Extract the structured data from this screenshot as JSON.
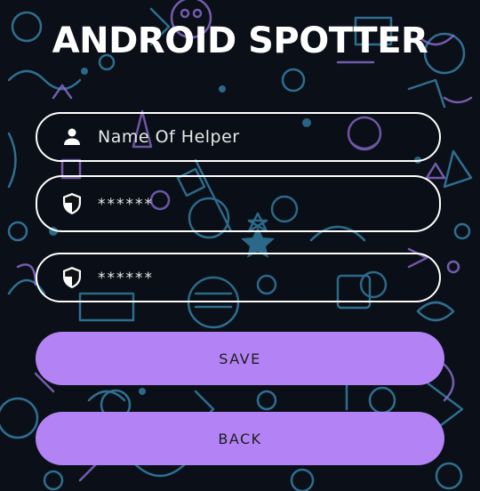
{
  "app": {
    "title": "ANDROID SPOTTER"
  },
  "form": {
    "name_field": {
      "placeholder": "Name Of Helper",
      "value": "",
      "icon": "person-icon"
    },
    "password_field": {
      "placeholder": "******",
      "value": "",
      "icon": "shield-icon"
    },
    "confirm_password_field": {
      "placeholder": "******",
      "value": "",
      "icon": "shield-icon"
    }
  },
  "buttons": {
    "save_label": "SAVE",
    "back_label": "BACK"
  },
  "colors": {
    "background": "#0b0f18",
    "doodle_blue": "#3a8fb8",
    "doodle_purple": "#8e6fd1",
    "button": "#b383f5",
    "text": "#ffffff"
  }
}
